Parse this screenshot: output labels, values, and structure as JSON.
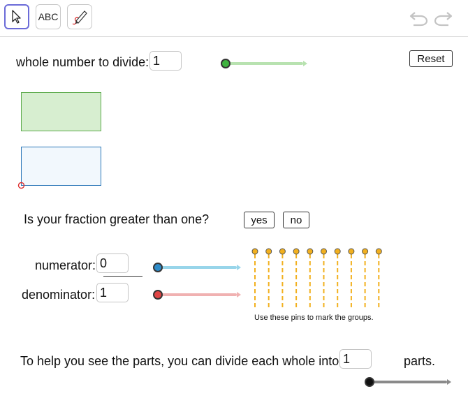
{
  "toolbar": {
    "abc_label": "ABC"
  },
  "whole": {
    "label": "whole number to divide:",
    "value": "1",
    "reset_label": "Reset",
    "slider_value": 1
  },
  "question": {
    "text": "Is your fraction greater than one?",
    "yes_label": "yes",
    "no_label": "no"
  },
  "numerator": {
    "label": "numerator:",
    "value": "0",
    "slider_value": 0
  },
  "denominator": {
    "label": "denominator:",
    "value": "1",
    "slider_value": 1
  },
  "pins": {
    "count": 10,
    "caption": "Use these pins to mark the groups."
  },
  "parts": {
    "prefix": "To help you see the parts, you can divide each whole into",
    "value": "1",
    "suffix": "parts.",
    "slider_value": 1
  },
  "colors": {
    "green_slider": "#3fb33f",
    "green_track": "#b8e2b0",
    "blue_slider": "#2e8bc8",
    "blue_track": "#98d5ea",
    "red_slider": "#e04545",
    "red_track": "#f0b1b1",
    "pin": "#f2b01e",
    "green_rect_fill": "#d7eed0",
    "green_rect_border": "#5caa4b",
    "blue_rect_fill": "#f2f8fd",
    "blue_rect_border": "#2a76b8"
  }
}
